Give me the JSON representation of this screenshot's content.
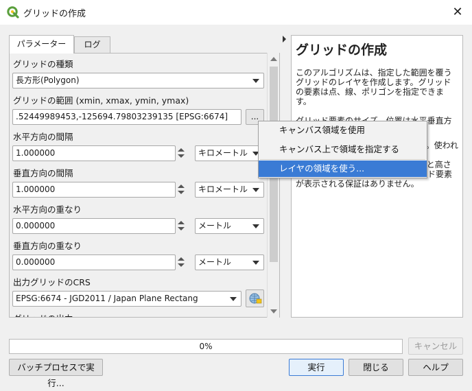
{
  "window": {
    "title": "グリッドの作成",
    "close_glyph": "✕"
  },
  "tabs": [
    {
      "label": "パラメーター",
      "active": true
    },
    {
      "label": "ログ",
      "active": false
    }
  ],
  "params": {
    "grid_type": {
      "label": "グリッドの種類",
      "value": "長方形(Polygon)"
    },
    "grid_extent": {
      "label": "グリッドの範囲 (xmin, xmax, ymin, ymax)",
      "value": ".52449989453,-125694.79803239135 [EPSG:6674]",
      "browse_label": "..."
    },
    "h_spacing": {
      "label": "水平方向の間隔",
      "value": "1.000000",
      "unit": "キロメートル"
    },
    "v_spacing": {
      "label": "垂直方向の間隔",
      "value": "1.000000",
      "unit": "キロメートル"
    },
    "h_overlay": {
      "label": "水平方向の重なり",
      "value": "0.000000",
      "unit": "メートル"
    },
    "v_overlay": {
      "label": "垂直方向の重なり",
      "value": "0.000000",
      "unit": "メートル"
    },
    "crs": {
      "label": "出力グリッドのCRS",
      "value": "EPSG:6674 - JGD2011 / Japan Plane Rectang"
    },
    "output_label_partial": "グリッドの出力"
  },
  "extent_menu": {
    "items": [
      {
        "label": "キャンバス領域を使用",
        "highlighted": false
      },
      {
        "label": "キャンバス上で領域を指定する",
        "highlighted": false
      },
      {
        "label": "レイヤの領域を使う...",
        "highlighted": true
      }
    ]
  },
  "help": {
    "title": "グリッドの作成",
    "paragraphs": [
      "このアルゴリズムは、指定した範囲を覆うグリッドのレイヤを作成します。グリッドの要素は点、線、ポリゴンを指定できます。",
      "グリッド要素のサイズ、位置は水平垂直方向に定義されます。",
      "ます。使われ",
      "の配置の基準点です。もし範囲の幅と高さが間隔の整数倍でない場合、グリッド要素が表示される保証はありません。"
    ]
  },
  "progress": {
    "value": 0,
    "text": "0%"
  },
  "buttons": {
    "cancel": "キャンセル",
    "batch": "バッチプロセスで実行...",
    "run": "実行",
    "close": "閉じる",
    "help": "ヘルプ"
  },
  "colors": {
    "accent": "#3a7bd5",
    "qgis_green": "#5a9f3c"
  }
}
